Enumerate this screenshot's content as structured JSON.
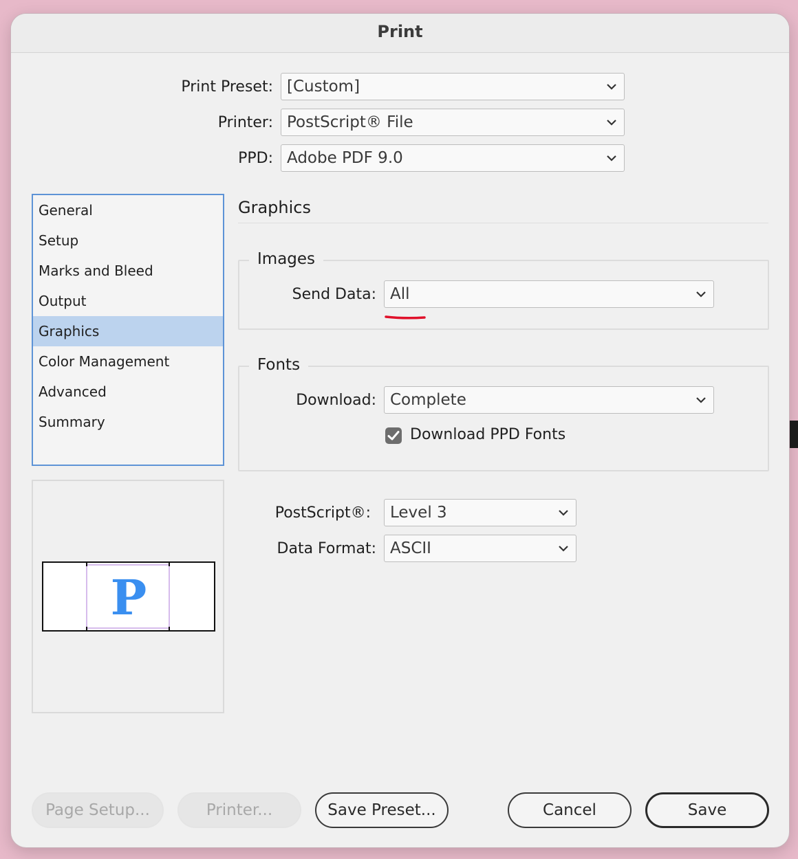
{
  "window": {
    "title": "Print"
  },
  "top_fields": {
    "print_preset": {
      "label": "Print Preset:",
      "value": "[Custom]"
    },
    "printer": {
      "label": "Printer:",
      "value": "PostScript® File"
    },
    "ppd": {
      "label": "PPD:",
      "value": "Adobe PDF 9.0"
    }
  },
  "sidebar": {
    "selected": "Graphics",
    "items": [
      {
        "label": "General"
      },
      {
        "label": "Setup"
      },
      {
        "label": "Marks and Bleed"
      },
      {
        "label": "Output"
      },
      {
        "label": "Graphics"
      },
      {
        "label": "Color Management"
      },
      {
        "label": "Advanced"
      },
      {
        "label": "Summary"
      }
    ]
  },
  "preview": {
    "glyph": "P"
  },
  "panel": {
    "title": "Graphics",
    "images": {
      "legend": "Images",
      "send_data": {
        "label": "Send Data:",
        "value": "All"
      }
    },
    "fonts": {
      "legend": "Fonts",
      "download": {
        "label": "Download:",
        "value": "Complete"
      },
      "download_ppd_fonts": {
        "label": "Download PPD Fonts",
        "checked": true
      }
    },
    "postscript": {
      "label": "PostScript®:",
      "value": "Level 3"
    },
    "data_format": {
      "label": "Data Format:",
      "value": "ASCII"
    }
  },
  "buttons": {
    "page_setup": "Page Setup...",
    "printer": "Printer...",
    "save_preset": "Save Preset...",
    "cancel": "Cancel",
    "save": "Save"
  },
  "colors": {
    "sidebar_selection": "#bcd3ee",
    "sidebar_border": "#5d93d6",
    "annotation_red": "#e0102a",
    "preview_glyph": "#3a8ff0"
  },
  "icons": {
    "dropdown": "chevron-down-icon",
    "checkbox": "checkmark-icon"
  }
}
